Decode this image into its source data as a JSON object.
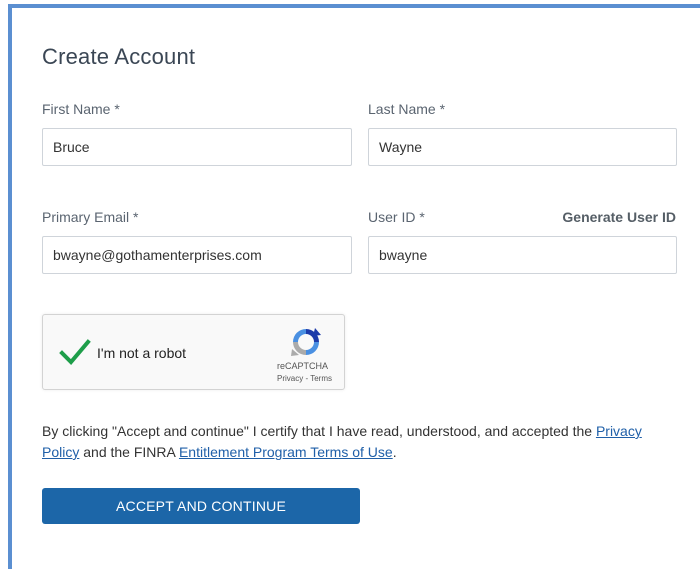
{
  "form": {
    "title": "Create Account",
    "first_name": {
      "label": "First Name *",
      "value": "Bruce"
    },
    "last_name": {
      "label": "Last Name *",
      "value": "Wayne"
    },
    "email": {
      "label": "Primary Email *",
      "value": "bwayne@gothamenterprises.com"
    },
    "user_id": {
      "label": "User ID *",
      "value": "bwayne",
      "generate_label": "Generate User ID"
    }
  },
  "captcha": {
    "label": "I'm not a robot",
    "brand": "reCAPTCHA",
    "privacy": "Privacy",
    "separator": " - ",
    "terms": "Terms",
    "checked": true,
    "check_color": "#1e9e4a"
  },
  "legal": {
    "text_before": "By clicking \"Accept and continue\" I certify that I have read, understood, and accepted the ",
    "privacy_link": "Privacy Policy",
    "text_middle": " and the FINRA ",
    "terms_link": "Entitlement Program Terms of Use",
    "text_after": "."
  },
  "actions": {
    "accept_label": "ACCEPT AND CONTINUE"
  },
  "colors": {
    "accent": "#1c66a8",
    "frame_border": "#5b8fd1",
    "link": "#1f5fa8"
  }
}
